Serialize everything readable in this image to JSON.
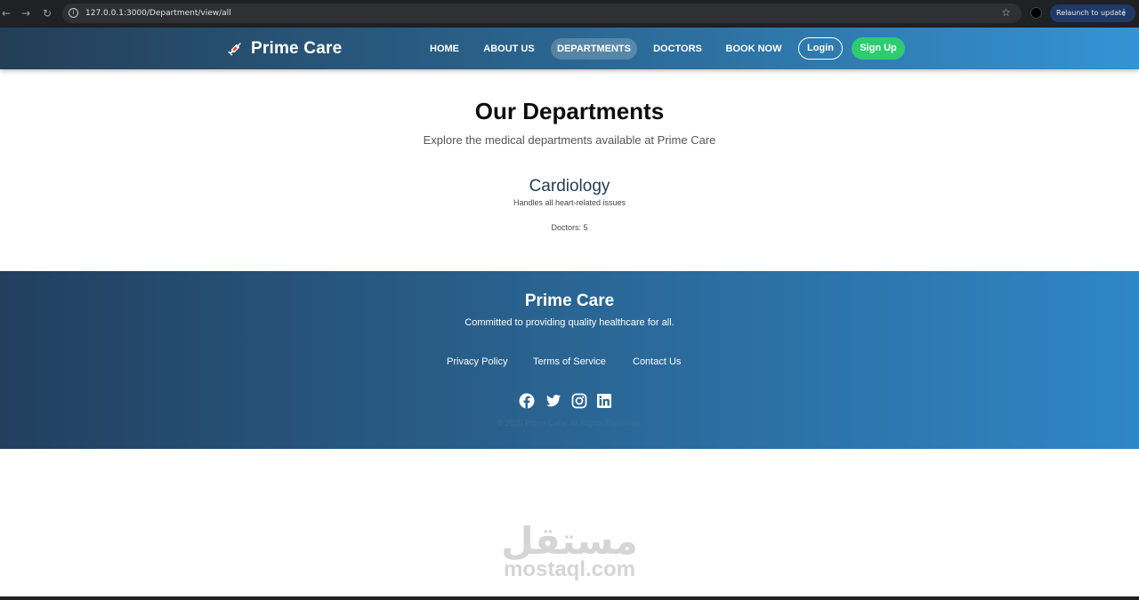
{
  "browser": {
    "url": "127.0.0.1:3000/Department/view/all",
    "relaunch_label": "Relaunch to update"
  },
  "header": {
    "brand": "Prime Care",
    "nav": [
      {
        "label": "HOME",
        "active": false
      },
      {
        "label": "ABOUT US",
        "active": false
      },
      {
        "label": "DEPARTMENTS",
        "active": true
      },
      {
        "label": "DOCTORS",
        "active": false
      },
      {
        "label": "BOOK NOW",
        "active": false
      }
    ],
    "login_label": "Login",
    "signup_label": "Sign Up"
  },
  "main": {
    "title": "Our Departments",
    "subtitle": "Explore the medical departments available at Prime Care",
    "departments": [
      {
        "name": "Cardiology",
        "description": "Handles all heart-related issues",
        "doctors": "Doctors: 5"
      }
    ]
  },
  "footer": {
    "title": "Prime Care",
    "tagline": "Committed to providing quality healthcare for all.",
    "links": [
      "Privacy Policy",
      "Terms of Service",
      "Contact Us"
    ],
    "social": [
      "facebook-icon",
      "twitter-icon",
      "instagram-icon",
      "linkedin-icon"
    ],
    "copyright": "© 2025 Prime Care. All Rights Reserved."
  },
  "watermark": {
    "arabic": "مستقل",
    "latin": "mostaql.com"
  },
  "colors": {
    "header_start": "#243e57",
    "header_end": "#3493d5",
    "signup": "#2ecc71",
    "footer_start": "#223f5e",
    "footer_end": "#2f86c6"
  }
}
